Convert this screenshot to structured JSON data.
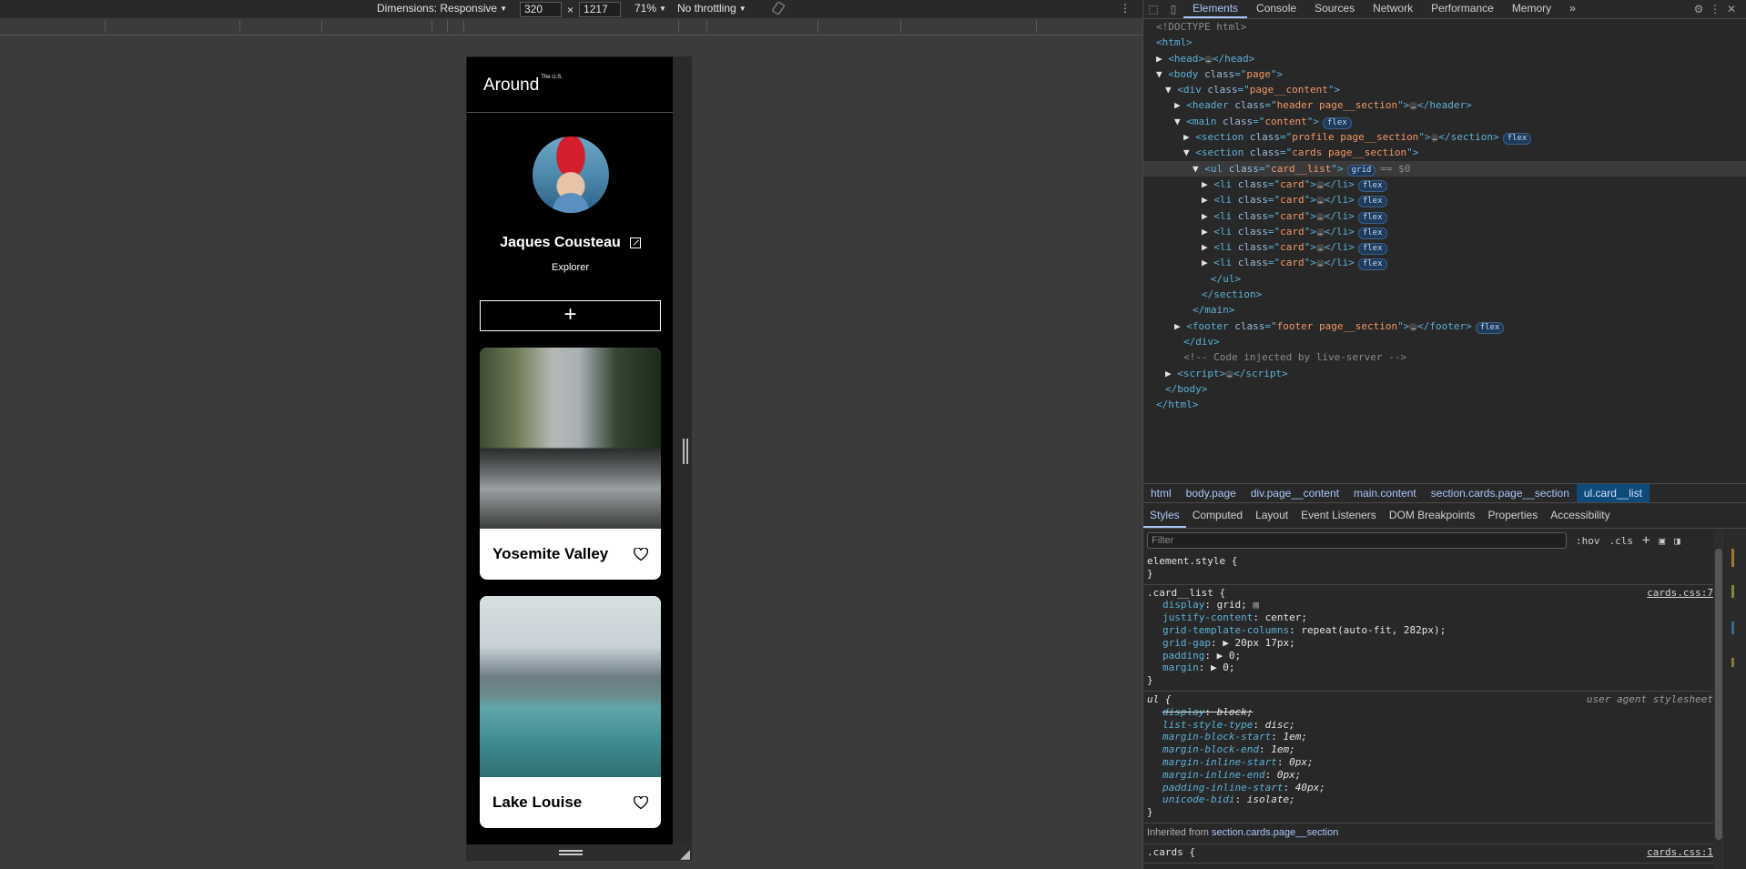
{
  "device_toolbar": {
    "dimensions_label": "Dimensions: Responsive",
    "width": "320",
    "times": "×",
    "height": "1217",
    "zoom": "71%",
    "throttling": "No throttling"
  },
  "site": {
    "logo": "Around",
    "logo_sup": "The U.S.",
    "profile_name": "Jaques Cousteau",
    "profile_job": "Explorer",
    "add_button": "+",
    "cards": [
      {
        "title": "Yosemite Valley"
      },
      {
        "title": "Lake Louise"
      }
    ]
  },
  "devtools": {
    "tabs": [
      "Elements",
      "Console",
      "Sources",
      "Network",
      "Performance",
      "Memory"
    ],
    "more_tabs": "»",
    "dom": {
      "doctype": "<!DOCTYPE html>",
      "html_open": "<html>",
      "head": "head",
      "body_class": "page",
      "div_class": "page__content",
      "header_class": "header page__section",
      "main_class": "content",
      "section_profile_class": "profile page__section",
      "section_cards_class": "cards page__section",
      "ul_class": "card__list",
      "li_class": "card",
      "ul_close": "</ul>",
      "section_close": "</section>",
      "main_close": "</main>",
      "footer_class": "footer page__section",
      "div_close": "</div>",
      "comment": "<!-- Code injected by live-server -->",
      "script": "script",
      "body_close": "</body>",
      "html_close": "</html>",
      "flex_badge": "flex",
      "grid_badge": "grid",
      "dollar0": "== $0",
      "ellipsis": "…"
    },
    "breadcrumbs": [
      "html",
      "body.page",
      "div.page__content",
      "main.content",
      "section.cards.page__section",
      "ul.card__list"
    ],
    "sub_tabs": [
      "Styles",
      "Computed",
      "Layout",
      "Event Listeners",
      "DOM Breakpoints",
      "Properties",
      "Accessibility"
    ],
    "filter_placeholder": "Filter",
    "hov": ":hov",
    "cls": ".cls",
    "rules": {
      "element_style": "element.style {",
      "close_brace": "}",
      "card_list_selector": ".card__list {",
      "card_list_src": "cards.css:7",
      "card_list_props": [
        {
          "name": "display",
          "value": "grid;"
        },
        {
          "name": "justify-content",
          "value": "center;"
        },
        {
          "name": "grid-template-columns",
          "value": "repeat(auto-fit, 282px);"
        },
        {
          "name": "grid-gap",
          "value": "▶ 20px 17px;"
        },
        {
          "name": "padding",
          "value": "▶ 0;"
        },
        {
          "name": "margin",
          "value": "▶ 0;"
        }
      ],
      "ul_selector": "ul {",
      "ul_src": "user agent stylesheet",
      "ul_props": [
        {
          "name": "display",
          "value": "block;",
          "struck": true
        },
        {
          "name": "list-style-type",
          "value": "disc;"
        },
        {
          "name": "margin-block-start",
          "value": "1em;"
        },
        {
          "name": "margin-block-end",
          "value": "1em;"
        },
        {
          "name": "margin-inline-start",
          "value": "0px;"
        },
        {
          "name": "margin-inline-end",
          "value": "0px;"
        },
        {
          "name": "padding-inline-start",
          "value": "40px;"
        },
        {
          "name": "unicode-bidi",
          "value": "isolate;"
        }
      ],
      "inherited_label": "Inherited from",
      "inherited_link": "section.cards.page__section",
      "cards_selector": ".cards {",
      "cards_src": "cards.css:1"
    }
  }
}
